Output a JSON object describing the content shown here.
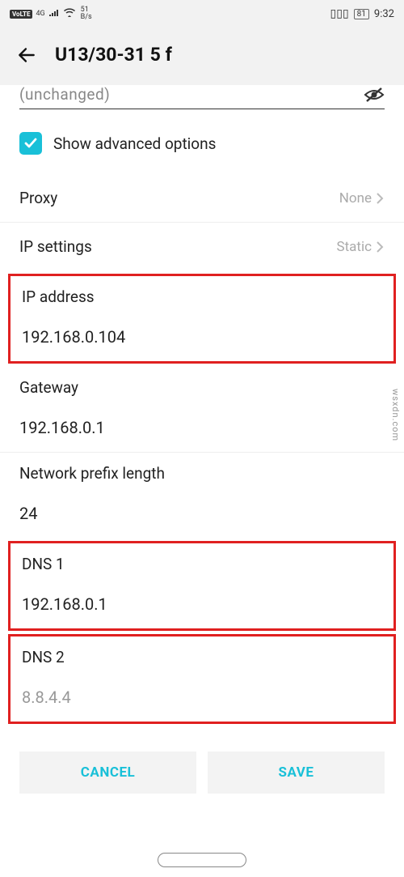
{
  "statusbar": {
    "volte": "VoLTE",
    "net_gen": "4G",
    "speed_num": "51",
    "speed_unit": "B/s",
    "battery": "81",
    "time": "9:32"
  },
  "header": {
    "title": "U13/30-31 5 f"
  },
  "password_row": {
    "text": "(unchanged)"
  },
  "advanced": {
    "label": "Show advanced options"
  },
  "proxy": {
    "label": "Proxy",
    "value": "None"
  },
  "ip_settings": {
    "label": "IP settings",
    "value": "Static"
  },
  "ip_address": {
    "label": "IP address",
    "value": "192.168.0.104"
  },
  "gateway": {
    "label": "Gateway",
    "value": "192.168.0.1"
  },
  "prefix": {
    "label": "Network prefix length",
    "value": "24"
  },
  "dns1": {
    "label": "DNS 1",
    "value": "192.168.0.1"
  },
  "dns2": {
    "label": "DNS 2",
    "placeholder": "8.8.4.4"
  },
  "buttons": {
    "cancel": "CANCEL",
    "save": "SAVE"
  },
  "watermark": "wsxdn.com"
}
